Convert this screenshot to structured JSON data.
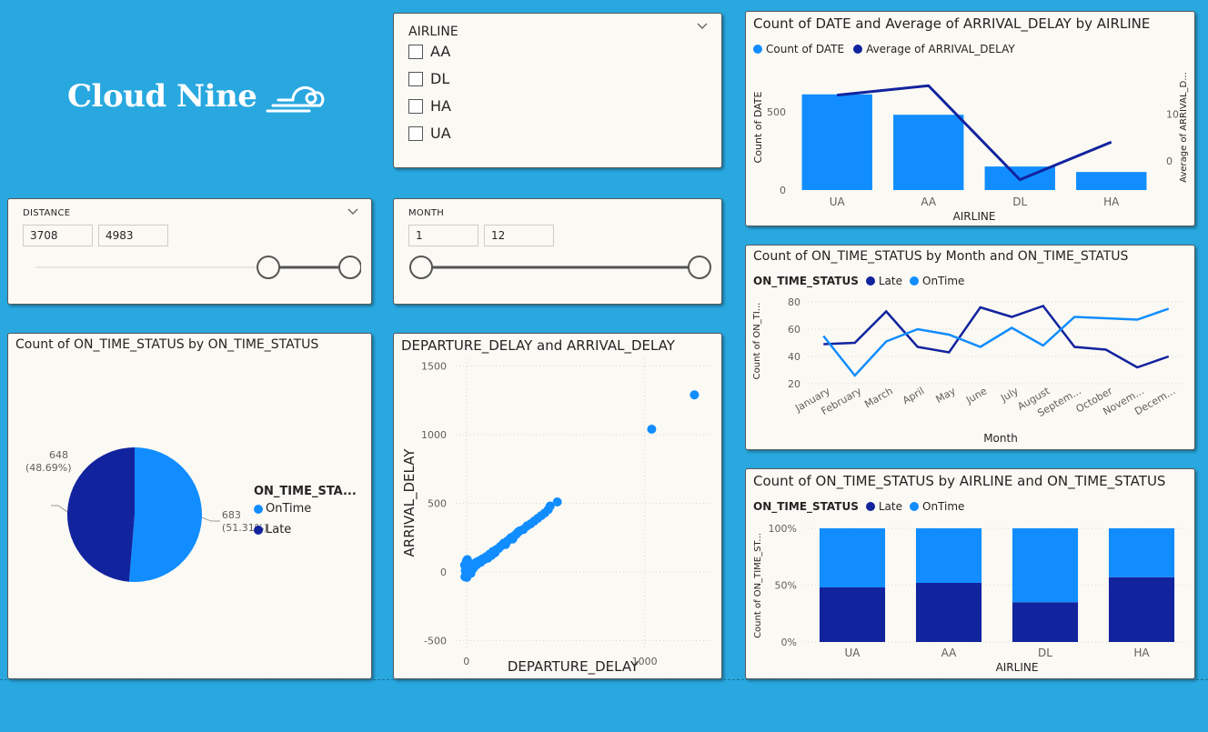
{
  "logo": {
    "text": "Cloud Nine",
    "icon": "cloud-icon"
  },
  "airline_slicer": {
    "title": "AIRLINE",
    "items": [
      {
        "label": "AA",
        "checked": false
      },
      {
        "label": "DL",
        "checked": false
      },
      {
        "label": "HA",
        "checked": false
      },
      {
        "label": "UA",
        "checked": false
      }
    ]
  },
  "distance_slicer": {
    "title": "DISTANCE",
    "min_value": "3708",
    "max_value": "4983",
    "low_fraction": 0.74,
    "high_fraction": 1.0
  },
  "month_slicer": {
    "title": "MONTH",
    "min_value": "1",
    "max_value": "12",
    "low_fraction": 0.0,
    "high_fraction": 1.0
  },
  "chart_data": [
    {
      "id": "combo",
      "type": "bar",
      "title": "Count of DATE and Average of ARRIVAL_DELAY by AIRLINE",
      "xlabel": "AIRLINE",
      "ylabel": "Count of DATE",
      "y2label": "Average of ARRIVAL_D...",
      "categories": [
        "UA",
        "AA",
        "DL",
        "HA"
      ],
      "series": [
        {
          "name": "Count of DATE",
          "type": "bar",
          "values": [
            610,
            480,
            150,
            115
          ],
          "color": "#118dff"
        },
        {
          "name": "Average of ARRIVAL_DELAY",
          "type": "line",
          "values": [
            14,
            16,
            -4,
            4
          ],
          "color": "#12239e"
        }
      ],
      "ylim": [
        0,
        800
      ],
      "y2lim": [
        -6.2,
        20.5
      ],
      "yticks": [
        "0",
        "500"
      ],
      "y2ticks": [
        "0",
        "10"
      ],
      "legend_position": "top-left"
    },
    {
      "id": "month_line",
      "type": "line",
      "title": "Count of ON_TIME_STATUS by Month and ON_TIME_STATUS",
      "xlabel": "Month",
      "ylabel": "Count of ON_TI...",
      "legend_title": "ON_TIME_STATUS",
      "categories": [
        "January",
        "February",
        "March",
        "April",
        "May",
        "June",
        "July",
        "August",
        "Septem...",
        "October",
        "Novem...",
        "Decem..."
      ],
      "series": [
        {
          "name": "Late",
          "values": [
            49,
            50,
            73,
            47,
            43,
            76,
            69,
            77,
            47,
            45,
            32,
            40
          ],
          "color": "#12239e"
        },
        {
          "name": "OnTime",
          "values": [
            55,
            26,
            51,
            60,
            56,
            47,
            61,
            48,
            69,
            68,
            67,
            75
          ],
          "color": "#118dff"
        }
      ],
      "ylim": [
        20,
        80
      ],
      "yticks": [
        "20",
        "40",
        "60",
        "80"
      ],
      "legend_position": "top-left"
    },
    {
      "id": "pie",
      "type": "pie",
      "title": "Count of ON_TIME_STATUS by ON_TIME_STATUS",
      "legend_title": "ON_TIME_STA...",
      "slices": [
        {
          "name": "OnTime",
          "value": 683,
          "label": "683",
          "pct": "(51.31%)",
          "color": "#118dff"
        },
        {
          "name": "Late",
          "value": 648,
          "label": "648",
          "pct": "(48.69%)",
          "color": "#12239e"
        }
      ],
      "legend_position": "right"
    },
    {
      "id": "scatter",
      "type": "scatter",
      "title": "DEPARTURE_DELAY and ARRIVAL_DELAY",
      "xlabel": "DEPARTURE_DELAY",
      "ylabel": "ARRIVAL_DELAY",
      "xlim": [
        -60,
        1380
      ],
      "ylim": [
        -550,
        1550
      ],
      "xticks": [
        "0",
        "1000"
      ],
      "yticks": [
        "-500",
        "0",
        "500",
        "1000",
        "1500"
      ],
      "points": [
        [
          -5,
          -30
        ],
        [
          -3,
          -20
        ],
        [
          0,
          -10
        ],
        [
          2,
          -25
        ],
        [
          5,
          0
        ],
        [
          8,
          10
        ],
        [
          10,
          -5
        ],
        [
          12,
          20
        ],
        [
          15,
          5
        ],
        [
          18,
          30
        ],
        [
          20,
          15
        ],
        [
          25,
          40
        ],
        [
          30,
          25
        ],
        [
          35,
          50
        ],
        [
          40,
          30
        ],
        [
          45,
          60
        ],
        [
          50,
          45
        ],
        [
          55,
          70
        ],
        [
          60,
          55
        ],
        [
          70,
          80
        ],
        [
          80,
          70
        ],
        [
          90,
          95
        ],
        [
          100,
          90
        ],
        [
          110,
          110
        ],
        [
          120,
          100
        ],
        [
          130,
          130
        ],
        [
          140,
          120
        ],
        [
          150,
          150
        ],
        [
          160,
          140
        ],
        [
          170,
          165
        ],
        [
          180,
          170
        ],
        [
          190,
          185
        ],
        [
          200,
          195
        ],
        [
          210,
          210
        ],
        [
          220,
          200
        ],
        [
          230,
          225
        ],
        [
          240,
          235
        ],
        [
          250,
          250
        ],
        [
          260,
          240
        ],
        [
          270,
          265
        ],
        [
          280,
          275
        ],
        [
          290,
          290
        ],
        [
          300,
          300
        ],
        [
          320,
          310
        ],
        [
          340,
          335
        ],
        [
          360,
          350
        ],
        [
          380,
          370
        ],
        [
          400,
          390
        ],
        [
          420,
          410
        ],
        [
          440,
          430
        ],
        [
          460,
          455
        ],
        [
          470,
          480
        ],
        [
          510,
          510
        ],
        [
          -10,
          50
        ],
        [
          0,
          80
        ],
        [
          5,
          90
        ],
        [
          -8,
          -35
        ],
        [
          -2,
          60
        ],
        [
          3,
          40
        ],
        [
          8,
          -15
        ],
        [
          15,
          65
        ],
        [
          25,
          -10
        ],
        [
          35,
          20
        ],
        [
          2,
          -40
        ],
        [
          -6,
          10
        ],
        [
          1040,
          1040
        ],
        [
          1280,
          1290
        ]
      ],
      "color": "#118dff"
    },
    {
      "id": "stacked",
      "type": "bar",
      "title": "Count of ON_TIME_STATUS by AIRLINE and ON_TIME_STATUS",
      "xlabel": "AIRLINE",
      "ylabel": "Count of ON_TIME_ST...",
      "legend_title": "ON_TIME_STATUS",
      "categories": [
        "UA",
        "AA",
        "DL",
        "HA"
      ],
      "series": [
        {
          "name": "Late",
          "values": [
            48,
            52,
            35,
            57
          ],
          "color": "#12239e"
        },
        {
          "name": "OnTime",
          "values": [
            52,
            48,
            65,
            43
          ],
          "color": "#118dff"
        }
      ],
      "ylim": [
        0,
        100
      ],
      "yticks": [
        "0%",
        "50%",
        "100%"
      ],
      "stacking": "percent",
      "legend_position": "top-left"
    }
  ]
}
